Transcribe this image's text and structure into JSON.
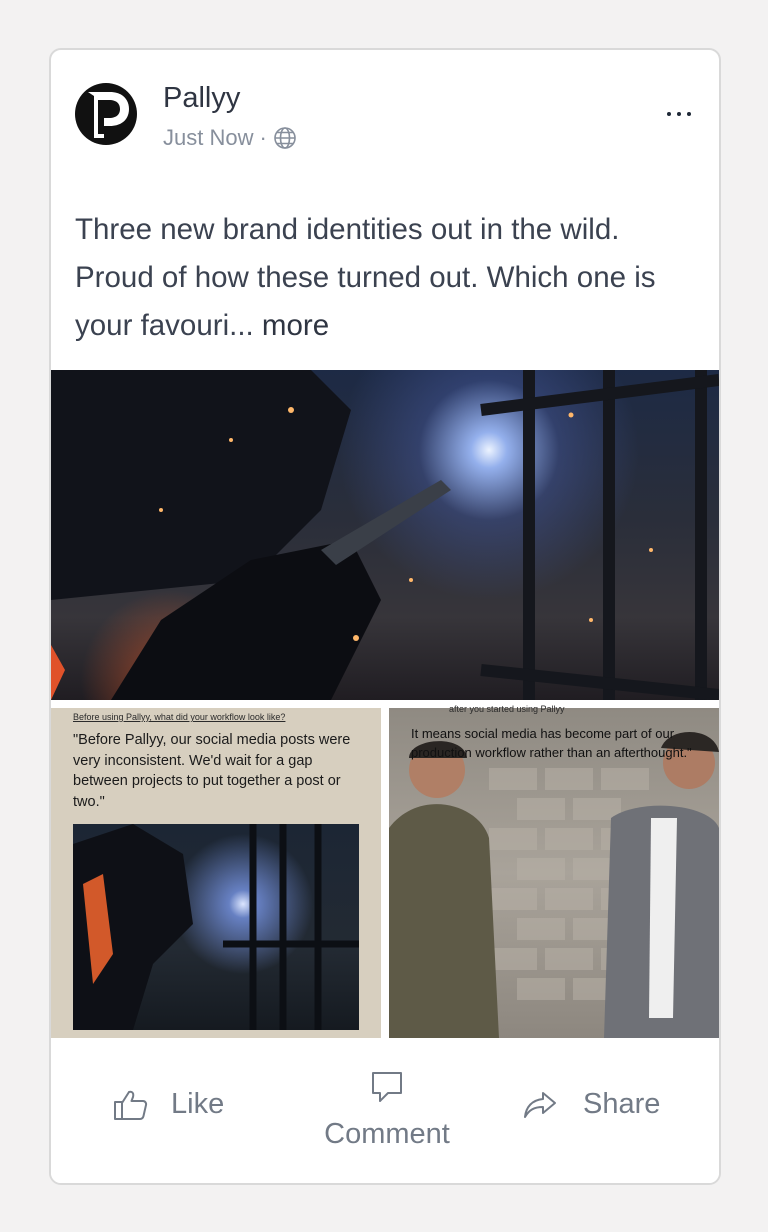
{
  "post": {
    "author": "Pallyy",
    "timestamp": "Just Now",
    "separator": "·",
    "visibility_icon": "globe-icon",
    "text": "Three new brand identities out in the wild. Proud of how these turned out. Which one is your favouri...",
    "see_more": "more"
  },
  "media": {
    "top_image_icon": "welder-photo",
    "left_card": {
      "heading": "Before using Pallyy, what did your workflow look like?",
      "quote": "\"Before Pallyy, our social media posts were very inconsistent. We'd wait for a gap between projects to put together a post or two.\""
    },
    "right_card": {
      "heading": "after you started using Pallyy",
      "quote": "It means social media has become part of our production workflow rather than an afterthought.\""
    }
  },
  "actions": {
    "like": "Like",
    "comment": "Comment",
    "share": "Share"
  }
}
